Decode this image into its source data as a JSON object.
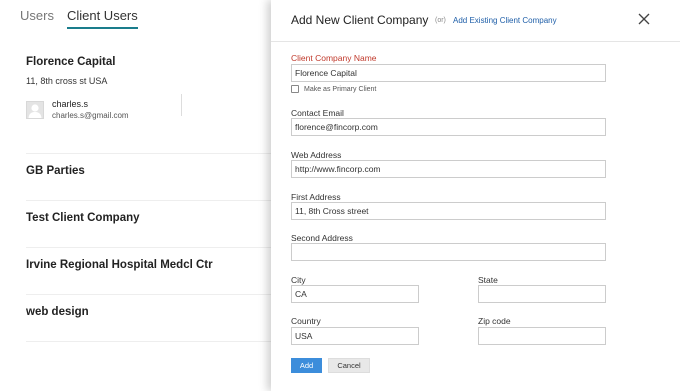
{
  "tabs": [
    {
      "label": "Users",
      "active": false
    },
    {
      "label": "Client Users",
      "active": true
    }
  ],
  "companies": [
    {
      "name": "Florence Capital",
      "address": "11, 8th cross st USA",
      "user": {
        "name": "charles.s",
        "email": "charles.s@gmail.com",
        "avatar_icon": "person-placeholder-icon"
      }
    },
    {
      "name": "GB Parties"
    },
    {
      "name": "Test Client Company"
    },
    {
      "name": "Irvine Regional Hospital Medcl Ctr"
    },
    {
      "name": "web design"
    }
  ],
  "modal": {
    "title": "Add New Client Company",
    "or_text": "(or)",
    "add_existing_link": "Add Existing Client Company",
    "close_icon": "close-icon",
    "fields": {
      "company_name": {
        "label": "Client Company Name",
        "value": "Florence Capital",
        "required": true
      },
      "primary_client": {
        "label": "Make as Primary Client",
        "checked": false
      },
      "contact_email": {
        "label": "Contact Email",
        "value": "florence@fincorp.com"
      },
      "web_address": {
        "label": "Web Address",
        "value": "http://www.fincorp.com"
      },
      "first_address": {
        "label": "First Address",
        "value": "11, 8th Cross street"
      },
      "second_address": {
        "label": "Second Address",
        "value": ""
      },
      "city": {
        "label": "City",
        "value": "CA"
      },
      "state": {
        "label": "State",
        "value": ""
      },
      "country": {
        "label": "Country",
        "value": "USA"
      },
      "zip": {
        "label": "Zip code",
        "value": ""
      }
    },
    "buttons": {
      "add": "Add",
      "cancel": "Cancel"
    }
  },
  "colors": {
    "required_label": "#c0392b",
    "link": "#1e5ea8",
    "primary_button": "#3c8ddb",
    "active_tab_underline": "#1a7d8c"
  }
}
